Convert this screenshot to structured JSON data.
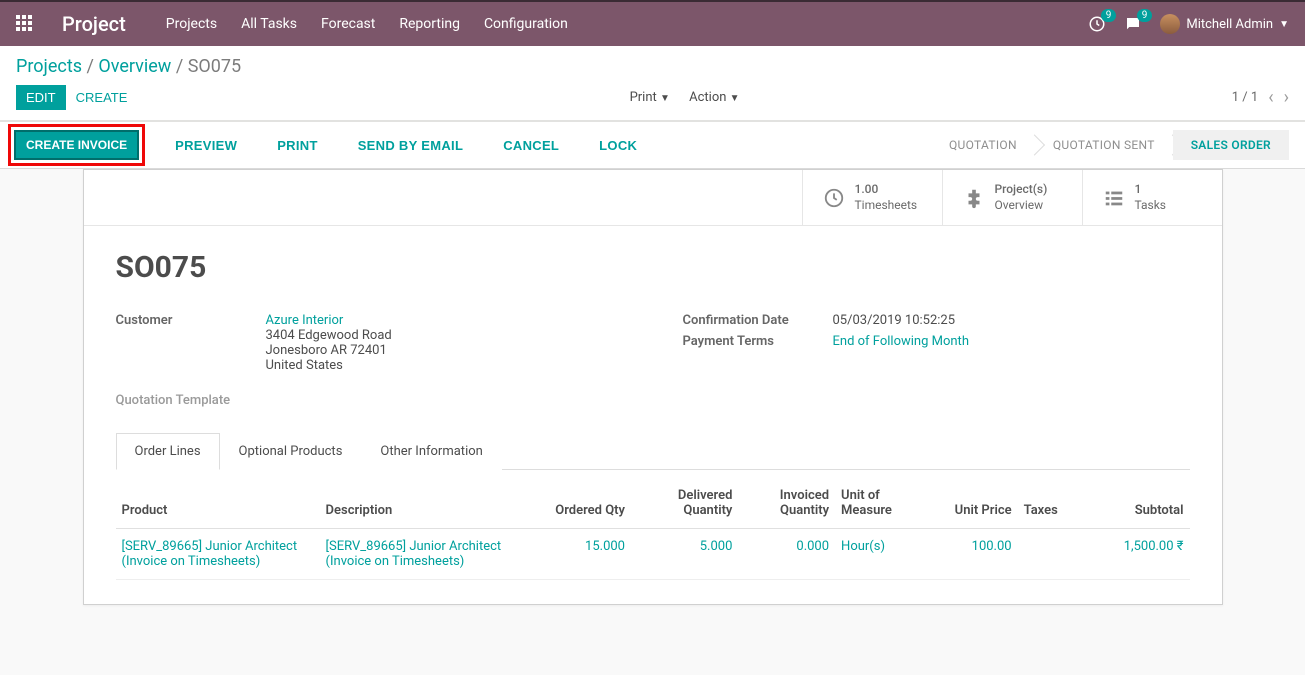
{
  "brand": "Project",
  "top_menu": [
    "Projects",
    "All Tasks",
    "Forecast",
    "Reporting",
    "Configuration"
  ],
  "badges": {
    "activities": "9",
    "messages": "9"
  },
  "user_name": "Mitchell Admin",
  "breadcrumb": {
    "a": "Projects",
    "b": "Overview",
    "c": "SO075"
  },
  "buttons": {
    "edit": "EDIT",
    "create": "CREATE",
    "print": "Print",
    "action": "Action"
  },
  "pager": {
    "pos": "1 / 1"
  },
  "status_actions": {
    "create_invoice": "CREATE INVOICE",
    "preview": "PREVIEW",
    "print": "PRINT",
    "send_email": "SEND BY EMAIL",
    "cancel": "CANCEL",
    "lock": "LOCK"
  },
  "steps": [
    "QUOTATION",
    "QUOTATION SENT",
    "SALES ORDER"
  ],
  "stat_buttons": {
    "timesheets": {
      "value": "1.00",
      "label": "Timesheets"
    },
    "projects": {
      "value": "Project(s)",
      "label": "Overview"
    },
    "tasks": {
      "value": "1",
      "label": "Tasks"
    }
  },
  "so_number": "SO075",
  "fields": {
    "customer_label": "Customer",
    "customer_name": "Azure Interior",
    "customer_addr1": "3404 Edgewood Road",
    "customer_addr2": "Jonesboro AR 72401",
    "customer_addr3": "United States",
    "confirmation_label": "Confirmation Date",
    "confirmation_value": "05/03/2019 10:52:25",
    "payment_label": "Payment Terms",
    "payment_value": "End of Following Month",
    "quotation_template_label": "Quotation Template"
  },
  "tabs": [
    "Order Lines",
    "Optional Products",
    "Other Information"
  ],
  "table": {
    "headers": {
      "product": "Product",
      "description": "Description",
      "ordered": "Ordered Qty",
      "delivered": "Delivered Quantity",
      "invoiced": "Invoiced Quantity",
      "uom": "Unit of Measure",
      "price": "Unit Price",
      "taxes": "Taxes",
      "subtotal": "Subtotal"
    },
    "rows": [
      {
        "product": "[SERV_89665] Junior Architect (Invoice on Timesheets)",
        "description": "[SERV_89665] Junior Architect (Invoice on Timesheets)",
        "ordered": "15.000",
        "delivered": "5.000",
        "invoiced": "0.000",
        "uom": "Hour(s)",
        "price": "100.00",
        "taxes": "",
        "subtotal": "1,500.00 ₹"
      }
    ]
  }
}
